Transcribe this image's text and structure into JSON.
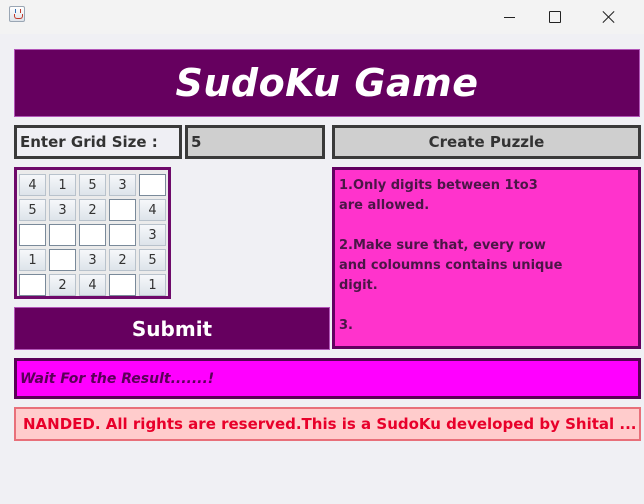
{
  "window": {
    "icon": "java-cup-icon",
    "controls": [
      "minimize-icon",
      "maximize-icon",
      "close-icon"
    ]
  },
  "header": {
    "title": "SudoKu Game",
    "background": "#66005f"
  },
  "grid_size": {
    "label": "Enter Grid Size :",
    "value": "5"
  },
  "create_button": {
    "label": "Create Puzzle"
  },
  "board": {
    "rows": [
      [
        "4",
        "1",
        "5",
        "3",
        ""
      ],
      [
        "5",
        "3",
        "2",
        "",
        "4"
      ],
      [
        "",
        "",
        "",
        "",
        "3"
      ],
      [
        "1",
        "",
        "3",
        "2",
        "5"
      ],
      [
        "",
        "2",
        "4",
        "",
        "1"
      ]
    ]
  },
  "rules": {
    "lines": [
      "1.Only digits between 1to3",
      "are allowed.",
      "",
      "2.Make sure that, every row",
      "and coloumns contains unique",
      "digit.",
      "",
      "3."
    ],
    "background": "#ff33cc"
  },
  "submit": {
    "label": "Submit"
  },
  "result": {
    "text": "Wait For the Result.......!",
    "background": "#ff00ff"
  },
  "footer": {
    "text": "NANDED. All rights are reserved.This is a SudoKu developed by Shital ...",
    "color": "#e8002a"
  }
}
